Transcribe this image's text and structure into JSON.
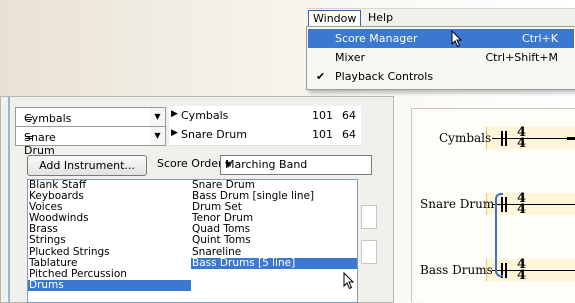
{
  "menubar": {
    "window_label": "Window",
    "help_label": "Help"
  },
  "window_menu": {
    "items": [
      {
        "label": "Score Manager",
        "shortcut": "Ctrl+K",
        "highlighted": true,
        "checked": false
      },
      {
        "label": "Mixer",
        "shortcut": "Ctrl+Shift+M",
        "highlighted": false,
        "checked": false
      },
      {
        "label": "Playback Controls",
        "shortcut": "",
        "highlighted": false,
        "checked": true
      }
    ]
  },
  "instruments": [
    {
      "name": "Cymbals",
      "mapped": "Cymbals",
      "col1": "101",
      "col2": "64"
    },
    {
      "name": "Snare Drum",
      "mapped": "Snare Drum",
      "col1": "101",
      "col2": "64"
    }
  ],
  "add_instrument_label": "Add Instrument...",
  "score_order": {
    "label": "Score Order:",
    "value": "Marching Band"
  },
  "families": [
    "Blank Staff",
    "Keyboards",
    "Voices",
    "Woodwinds",
    "Brass",
    "Strings",
    "Plucked Strings",
    "Tablature",
    "Pitched Percussion",
    "Drums"
  ],
  "family_selected": "Drums",
  "drum_instruments": [
    "Snare Drum",
    "Bass Drum [single line]",
    "Drum Set",
    "Tenor Drum",
    "Quad Toms",
    "Quint Toms",
    "Snareline",
    "Bass Drums [5 line]"
  ],
  "drum_selected": "Bass Drums [5 line]",
  "score": {
    "staves": [
      "Cymbals",
      "Snare Drum",
      "Bass Drums"
    ],
    "time_signature_top": "4",
    "time_signature_bottom": "4"
  },
  "colors": {
    "selection": "#3b78d0",
    "bracket": "#3b72c2"
  }
}
